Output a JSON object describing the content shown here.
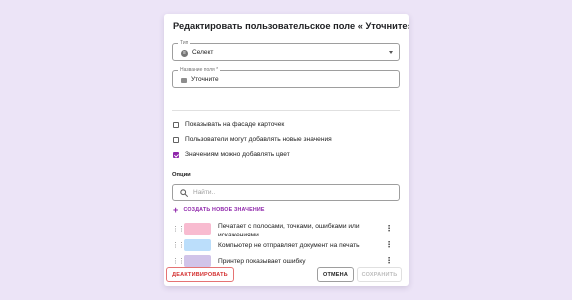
{
  "dialog": {
    "title": "Редактировать пользовательское поле « Уточните»"
  },
  "type_field": {
    "label": "Тип",
    "value": "Селект",
    "icon": "select-type-icon"
  },
  "name_field": {
    "label": "Название поля *",
    "value": "Уточните",
    "icon": "emoji-icon"
  },
  "checkboxes": [
    {
      "label": "Показывать на фасаде карточек",
      "checked": false
    },
    {
      "label": "Пользователи могут добавлять новые значения",
      "checked": false
    },
    {
      "label": "Значениям можно добавлять цвет",
      "checked": true
    }
  ],
  "options_section": {
    "label": "Опции",
    "search_placeholder": "Найти..",
    "create_label": "СОЗДАТЬ НОВОЕ ЗНАЧЕНИЕ"
  },
  "options": [
    {
      "label": "Печатает с полосами, точками, ошибками или искажениями",
      "color": "#f8bbd0"
    },
    {
      "label": "Компьютер не отправляет документ на печать",
      "color": "#bbdefb"
    },
    {
      "label": "Принтер показывает ошибку",
      "color": "#d1c4e9"
    }
  ],
  "footer": {
    "deactivate_label": "ДЕАКТИВИРОВАТЬ",
    "cancel_label": "ОТМЕНА",
    "save_label": "СОХРАНИТЬ"
  },
  "colors": {
    "accent": "#8e24aa",
    "danger": "#d32f2f",
    "background": "#ece4f7"
  }
}
